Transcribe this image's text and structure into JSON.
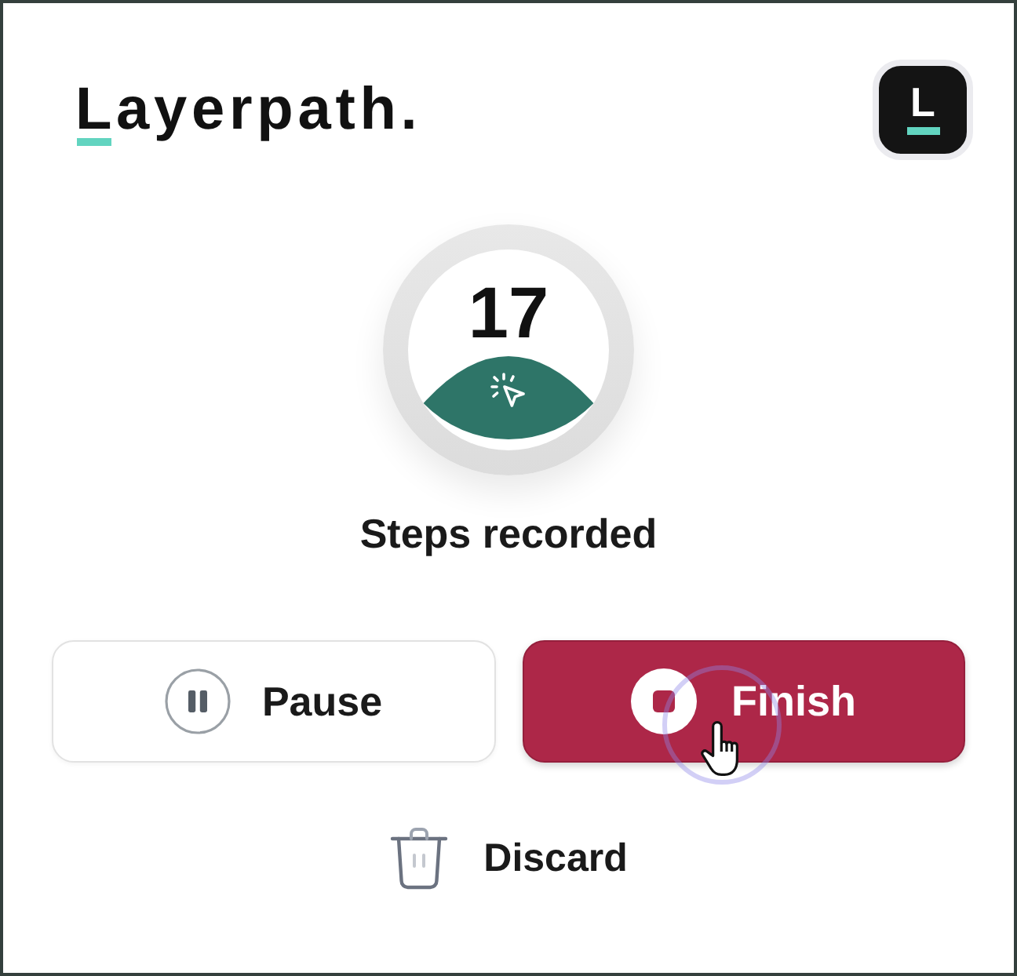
{
  "header": {
    "logo": "Layerpath.",
    "app_icon_letter": "L"
  },
  "counter": {
    "value": "17",
    "label": "Steps recorded"
  },
  "actions": [
    {
      "kind": "pause",
      "label": "Pause"
    },
    {
      "kind": "finish",
      "label": "Finish"
    }
  ],
  "discard": {
    "label": "Discard"
  }
}
